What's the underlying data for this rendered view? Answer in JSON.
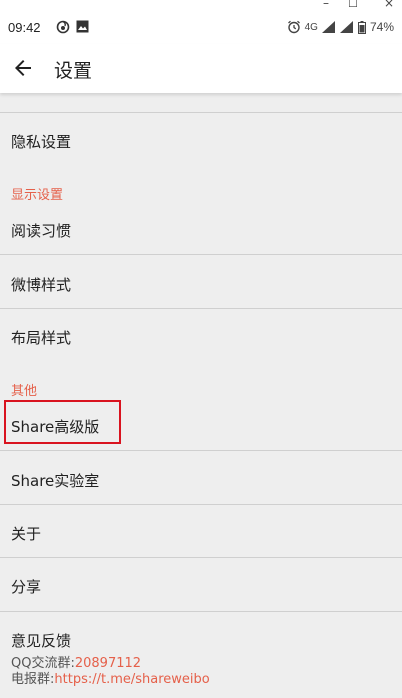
{
  "window_controls": {
    "minimize": "–",
    "maximize": "☐",
    "close": "×"
  },
  "status_bar": {
    "time": "09:42",
    "network": "4G",
    "battery": "74%"
  },
  "app_bar": {
    "title": "设置"
  },
  "settings": {
    "privacy": "隐私设置",
    "display_section": "显示设置",
    "reading_habits": "阅读习惯",
    "weibo_style": "微博样式",
    "layout_style": "布局样式",
    "other_section": "其他",
    "share_premium": "Share高级版",
    "share_lab": "Share实验室",
    "about": "关于",
    "share": "分享",
    "feedback": {
      "title": "意见反馈",
      "qq_label": "QQ交流群:",
      "qq_value": "20897112",
      "telegram_label": "电报群:",
      "telegram_value": "https://t.me/shareweibo"
    }
  },
  "colors": {
    "accent": "#e5604a",
    "highlight_box": "#d9131f",
    "background": "#eeeeee"
  }
}
